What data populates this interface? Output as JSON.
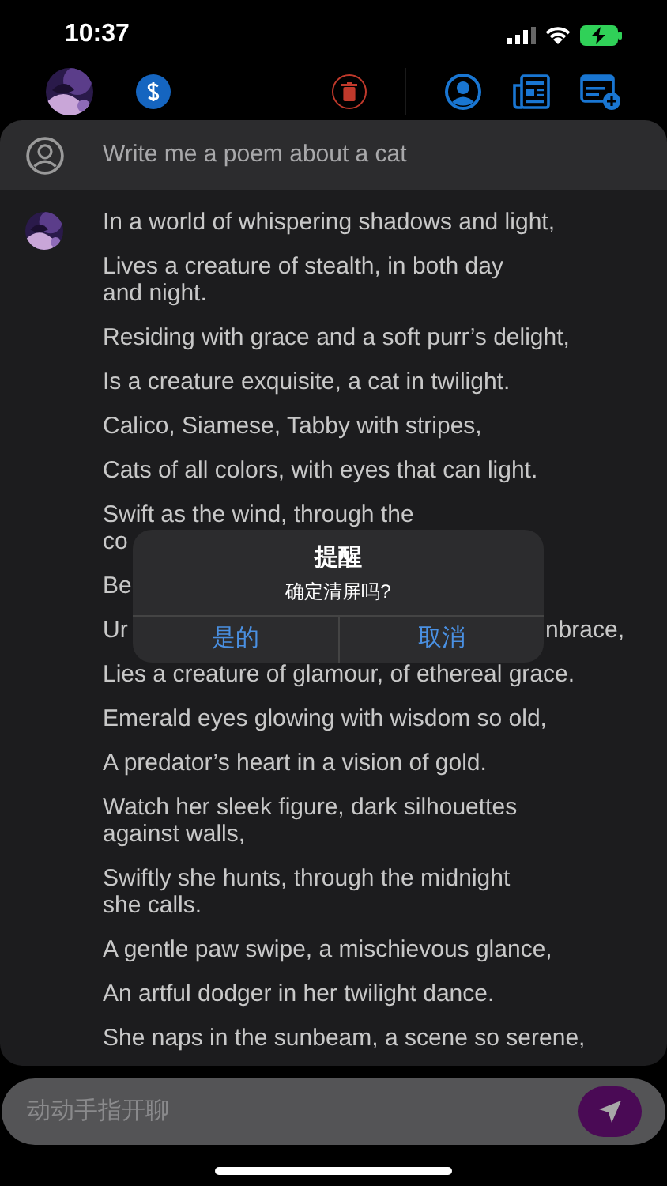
{
  "status_bar": {
    "time": "10:37"
  },
  "prompt": {
    "text": "Write me a poem about a cat"
  },
  "poem": [
    {
      "text": "In a world of whispering shadows and light,"
    },
    {
      "text": "Lives a creature of stealth, in both day\nand night."
    },
    {
      "text": "Residing with grace and a soft purr’s delight,"
    },
    {
      "text": "Is a creature exquisite, a cat in twilight."
    },
    {
      "text": "Calico, Siamese, Tabby with stripes,"
    },
    {
      "text": "Cats of all colors, with eyes that can light."
    },
    {
      "kind": "cut",
      "text": "Swift as the wind, through the",
      "left": "co"
    },
    {
      "kind": "covered",
      "left": "Be"
    },
    {
      "kind": "covered",
      "left": "Ur",
      "right": "nbrace,"
    },
    {
      "text": "Lies a creature of glamour, of ethereal grace."
    },
    {
      "text": "Emerald eyes glowing with wisdom so old,"
    },
    {
      "text": "A predator’s heart in a vision of gold."
    },
    {
      "text": "Watch her sleek figure, dark silhouettes\nagainst walls,"
    },
    {
      "text": "Swiftly she hunts, through the midnight\nshe calls."
    },
    {
      "text": "A gentle paw swipe, a mischievous glance,"
    },
    {
      "text": "An artful dodger in her twilight dance."
    },
    {
      "text": "She naps in the sunbeam, a scene so serene,"
    }
  ],
  "dialog": {
    "title": "提醒",
    "message": "确定清屏吗?",
    "buttons": [
      "是的",
      "取消"
    ]
  },
  "input": {
    "placeholder": "动动手指开聊"
  }
}
